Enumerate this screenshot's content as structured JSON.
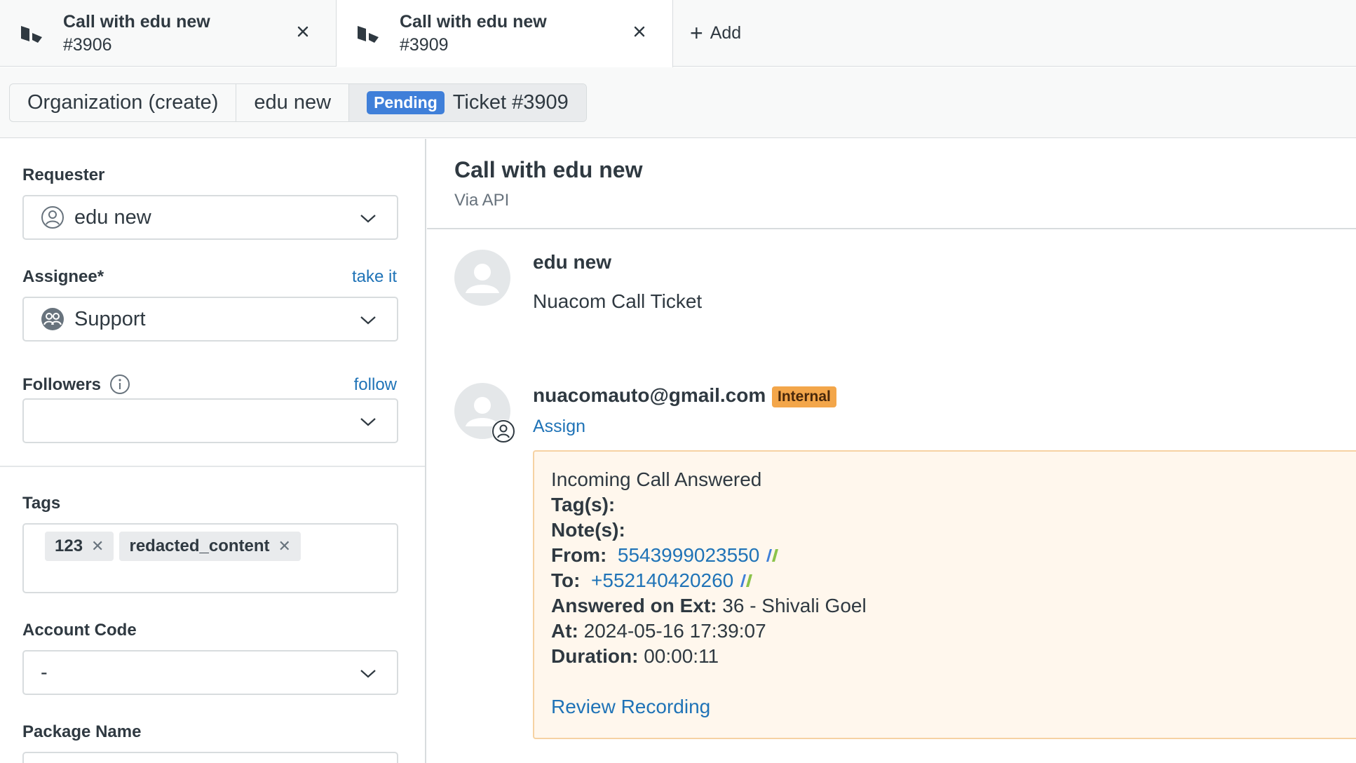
{
  "tabs": [
    {
      "title": "Call with edu new",
      "number": "#3906",
      "active": false
    },
    {
      "title": "Call with edu new",
      "number": "#3909",
      "active": true
    }
  ],
  "add_tab_label": "Add",
  "breadcrumb": {
    "org": "Organization (create)",
    "user": "edu new",
    "status_badge": "Pending",
    "ticket": "Ticket #3909"
  },
  "sidebar": {
    "requester_label": "Requester",
    "requester_value": "edu new",
    "assignee_label": "Assignee*",
    "assignee_link": "take it",
    "assignee_value": "Support",
    "followers_label": "Followers",
    "followers_link": "follow",
    "followers_value": "",
    "tags_label": "Tags",
    "tags": [
      "123",
      "redacted_content"
    ],
    "account_code_label": "Account Code",
    "account_code_value": "-",
    "package_name_label": "Package Name"
  },
  "ticket": {
    "title": "Call with edu new",
    "via": "Via API",
    "messages": [
      {
        "author": "edu new",
        "body": "Nuacom Call Ticket"
      },
      {
        "author": "nuacomauto@gmail.com",
        "badge": "Internal",
        "action": "Assign"
      }
    ],
    "note": {
      "heading": "Incoming Call Answered",
      "tags_label": "Tag(s):",
      "notes_label": "Note(s):",
      "from_label": "From:",
      "from_value": "5543999023550",
      "to_label": "To:",
      "to_value": "+552140420260",
      "ext_label": "Answered on Ext:",
      "ext_value": "36 - Shivali Goel",
      "at_label": "At:",
      "at_value": "2024-05-16 17:39:07",
      "duration_label": "Duration:",
      "duration_value": "00:00:11",
      "review_link": "Review Recording"
    }
  },
  "colors": {
    "accent": "#1f73b7",
    "pending_badge": "#3f7fd9",
    "internal_badge": "#f3a64a",
    "note_bg": "#fff7ed"
  }
}
